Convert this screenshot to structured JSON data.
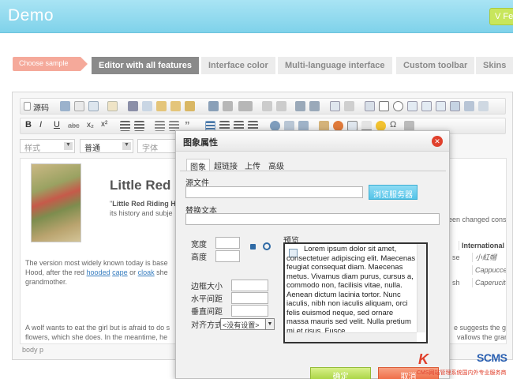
{
  "header": {
    "title": "Demo",
    "button_label": "V Fe"
  },
  "nav": {
    "sample_label": "Choose sample",
    "tabs": [
      "Editor with all features",
      "Interface color",
      "Multi-language interface",
      "Custom toolbar",
      "Skins"
    ]
  },
  "editor": {
    "toolbar": {
      "source_label": "源码"
    },
    "format": {
      "style": "样式",
      "normal": "普通",
      "font": "字体"
    },
    "content": {
      "heading": "Little Red",
      "intro_quote": "\"",
      "intro_bold": "Little Red Riding Ho",
      "intro_line2": "its history and subje",
      "para1_line1": "The version most widely known today is base",
      "para1_line2_pre": "Hood, after the red ",
      "link_hooded": "hooded",
      "link_cape": "cape",
      "para1_or": " or ",
      "link_cloak": "cloak",
      "para1_she": " she",
      "para1_line3": "grandmother.",
      "para2_line1": "A wolf wants to eat the girl but is afraid to do s",
      "para2_line2": "flowers, which she does. In the meantime, he",
      "right_line1": "een changed consi",
      "right_table_header": "International Name",
      "right_rows": [
        {
          "a": "se",
          "b": "小紅帽"
        },
        {
          "a": "",
          "b": "Cappuccetto R"
        },
        {
          "a": "sh",
          "b": "Caperucita Ro"
        }
      ],
      "right_para2_line1": "e suggests the girl p",
      "right_para2_line2": "vallows the grandm"
    },
    "statusbar": "body  p"
  },
  "dialog": {
    "title": "图象属性",
    "tabs": [
      "图象",
      "超链接",
      "上传",
      "高级"
    ],
    "source_label": "源文件",
    "source_value": "",
    "browse_label": "浏览服务器",
    "alt_label": "替换文本",
    "alt_value": "",
    "width_label": "宽度",
    "height_label": "高度",
    "preview_label": "预览",
    "border_label": "边框大小",
    "hspace_label": "水平间距",
    "vspace_label": "垂直间距",
    "align_label": "对齐方式",
    "align_value": "<没有设置>",
    "preview_text": "Lorem ipsum dolor sit amet, consectetuer adipiscing elit. Maecenas feugiat consequat diam. Maecenas metus. Vivamus diam purus, cursus a, commodo non, facilisis vitae, nulla. Aenean dictum lacinia tortor. Nunc iaculis, nibh non iaculis aliquam, orci felis euismod neque, sed ornare massa mauris sed velit. Nulla pretium mi et risus. Fusce",
    "ok_label": "确定",
    "cancel_label": "取消"
  },
  "watermark": {
    "k": "K",
    "rest": "SCMS",
    "line": "CMS网站管理系统国内外专业服务商"
  },
  "colors": {
    "header": "#7fd2ea",
    "sample": "#f5a99a",
    "browse": "#53c3e8",
    "ok": "#a9d443",
    "cancel": "#ef6b45",
    "close": "#e0402c"
  }
}
